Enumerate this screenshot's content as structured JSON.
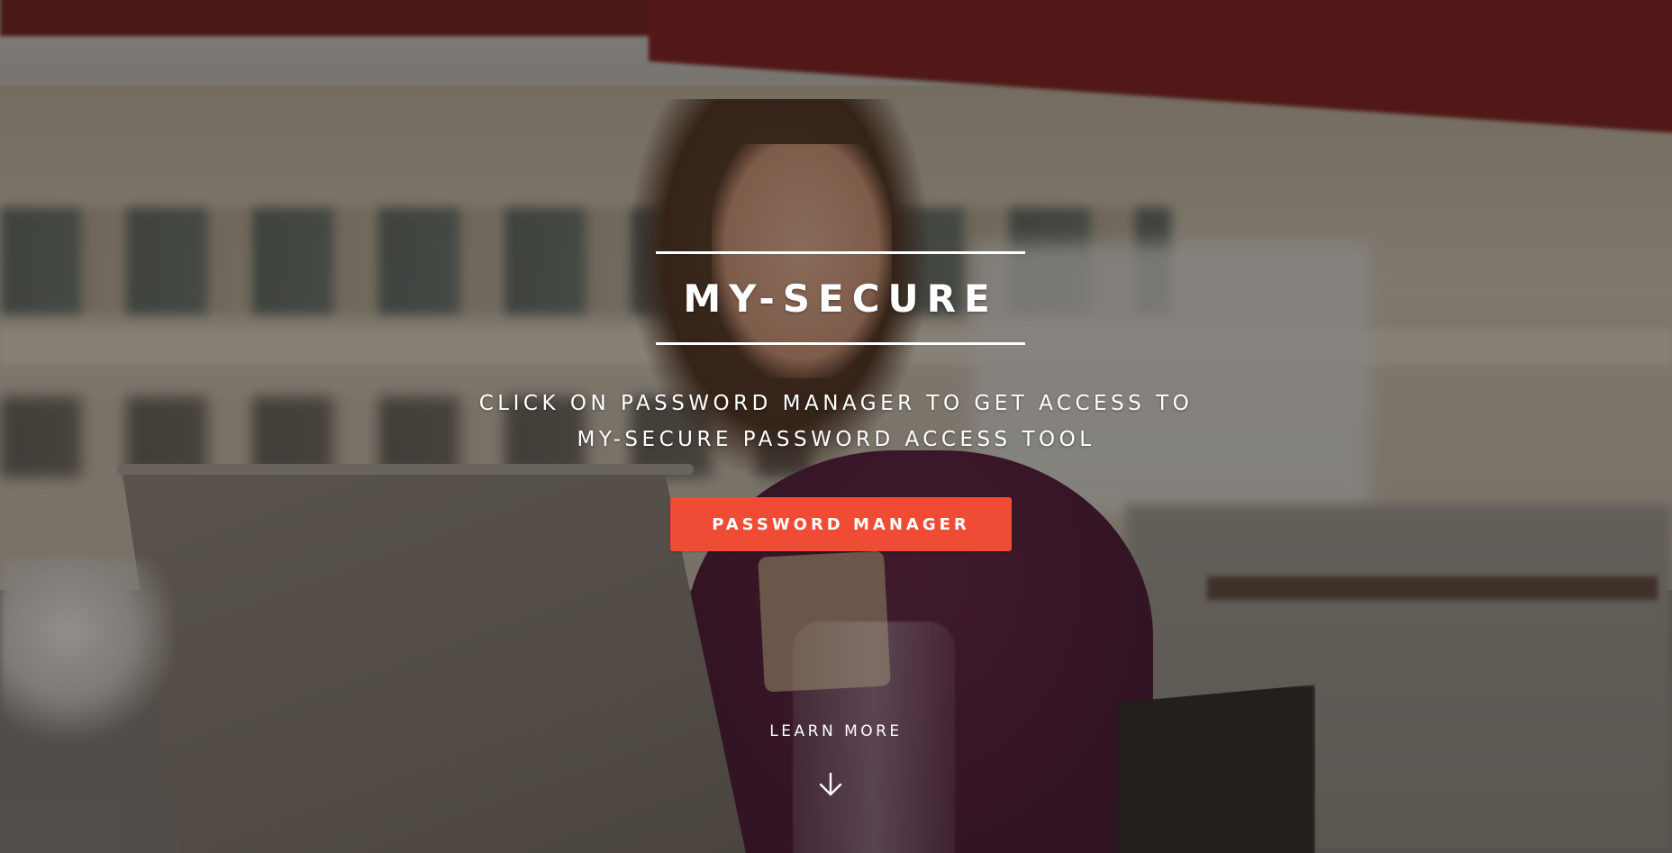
{
  "hero": {
    "title": "MY-SECURE",
    "subtitle_line1": "CLICK ON PASSWORD MANAGER TO GET ACCESS TO",
    "subtitle_line2": "MY-SECURE PASSWORD ACCESS TOOL",
    "cta_label": "PASSWORD MANAGER",
    "learn_more_label": "LEARN MORE",
    "scroll_icon": "arrow-down-icon"
  },
  "colors": {
    "accent": "#f04b35",
    "text": "#ffffff"
  }
}
